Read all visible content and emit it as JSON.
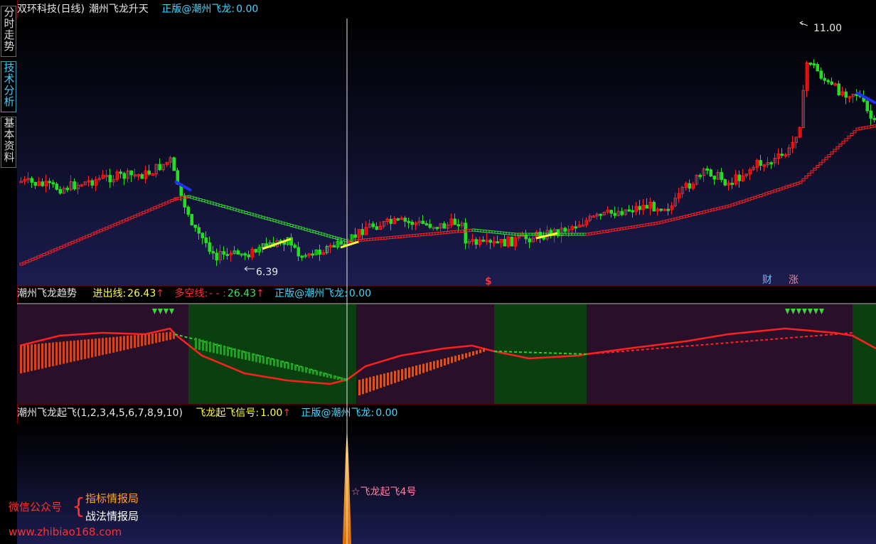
{
  "side_tabs": [
    {
      "label": "分时走势"
    },
    {
      "label": "技术分析"
    },
    {
      "label": "基本资料"
    }
  ],
  "main_panel": {
    "stock": "双环科技(日线)",
    "indicator": "潮州飞龙升天",
    "edition_label": "正版@潮州飞龙:",
    "edition_value": "0.00",
    "high_marker": "11.00",
    "low_marker": "6.39",
    "dollar_marker": "$",
    "badge_cai": "财",
    "badge_zhang": "涨"
  },
  "trend_panel": {
    "title": "潮州飞龙趋势",
    "jinchu_label": "进出线:",
    "jinchu_value": "26.43",
    "duokong_label": "多空线:",
    "duokong_mid": "- - :",
    "duokong_value": "26.43",
    "edition_label": "正版@潮州飞龙:",
    "edition_value": "0.00",
    "arrow": "↑"
  },
  "signal_panel": {
    "title": "潮州飞龙起飞(1,2,3,4,5,6,7,8,9,10)",
    "signal_label": "飞龙起飞信号:",
    "signal_value": "1.00",
    "edition_label": "正版@潮州飞龙:",
    "edition_value": "0.00",
    "signal_note": "☆飞龙起飞4号"
  },
  "watermark": {
    "wechat": "微信公众号",
    "brace": "{",
    "line1": "指标情报局",
    "line2": "战法情报局",
    "url": "www.zhibiao168.com"
  },
  "colors": {
    "up": "#ff2020",
    "down": "#20e020",
    "yellow": "#ffff30",
    "cyan": "#40e0ff",
    "panel_bg_top": "#000000",
    "panel_bg_bottom": "#1a1a4a"
  }
}
